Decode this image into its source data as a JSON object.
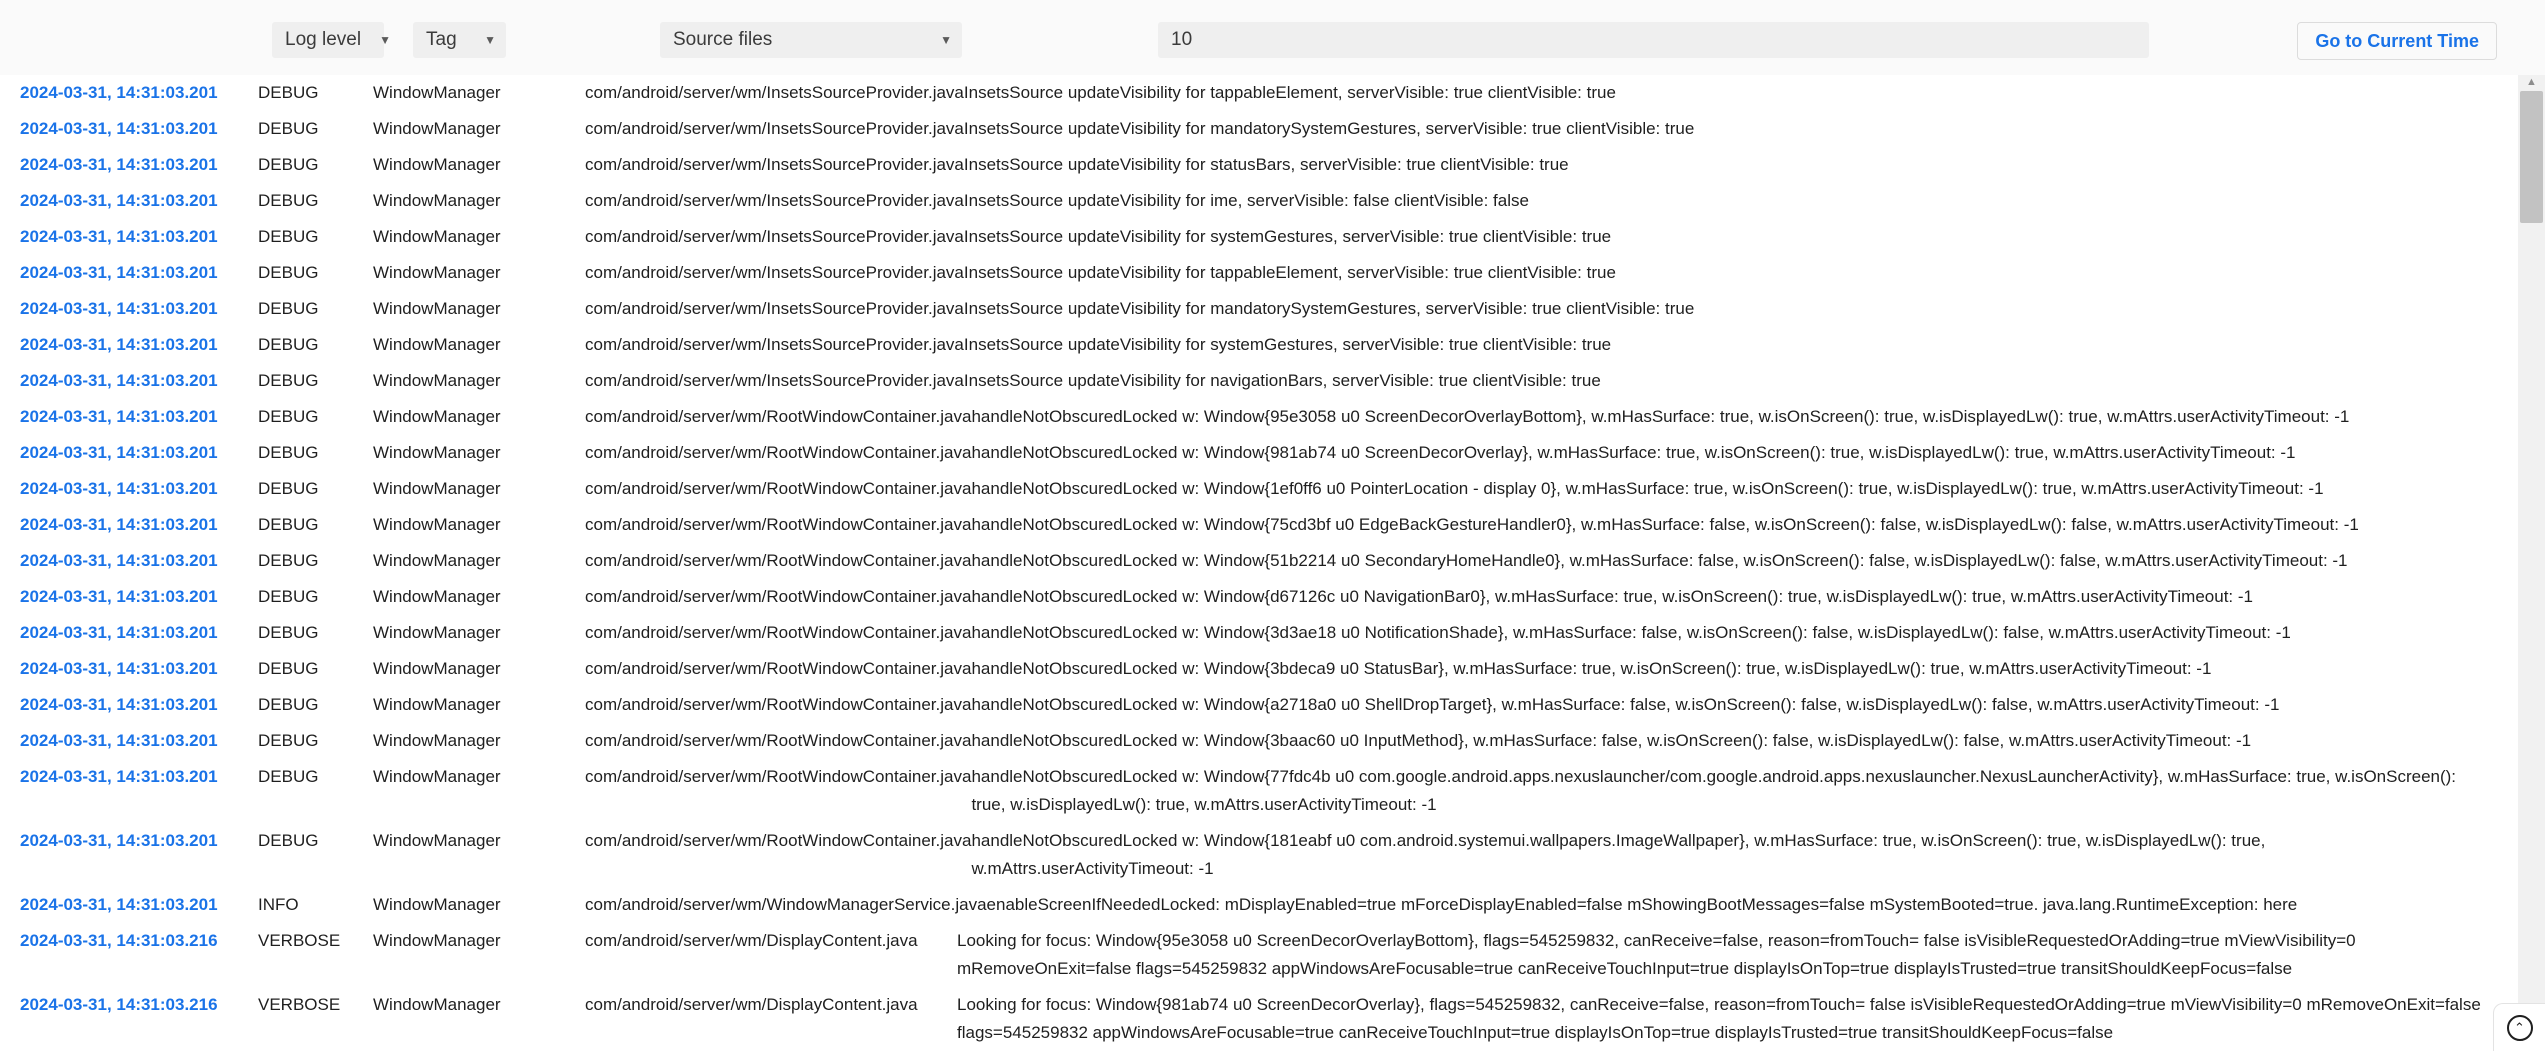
{
  "toolbar": {
    "log_level_label": "Log level",
    "tag_label": "Tag",
    "source_files_label": "Source files",
    "caret_glyph": "▼",
    "search_value": "10",
    "search_placeholder": "",
    "goto_current_time_label": "Go to Current Time"
  },
  "scrollbar": {
    "up_glyph": "▲",
    "down_glyph": "▼"
  },
  "scroll_to_top": {
    "glyph": "⌃"
  },
  "columns": [
    "timestamp",
    "level",
    "tag",
    "source",
    "message"
  ],
  "rows": [
    {
      "timestamp": "2024-03-31, 14:31:03.201",
      "level": "DEBUG",
      "tag": "WindowManager",
      "source": "com/android/server/wm/InsetsSourceProvider.java",
      "message": "InsetsSource updateVisibility for tappableElement, serverVisible: true clientVisible: true"
    },
    {
      "timestamp": "2024-03-31, 14:31:03.201",
      "level": "DEBUG",
      "tag": "WindowManager",
      "source": "com/android/server/wm/InsetsSourceProvider.java",
      "message": "InsetsSource updateVisibility for mandatorySystemGestures, serverVisible: true clientVisible: true"
    },
    {
      "timestamp": "2024-03-31, 14:31:03.201",
      "level": "DEBUG",
      "tag": "WindowManager",
      "source": "com/android/server/wm/InsetsSourceProvider.java",
      "message": "InsetsSource updateVisibility for statusBars, serverVisible: true clientVisible: true"
    },
    {
      "timestamp": "2024-03-31, 14:31:03.201",
      "level": "DEBUG",
      "tag": "WindowManager",
      "source": "com/android/server/wm/InsetsSourceProvider.java",
      "message": "InsetsSource updateVisibility for ime, serverVisible: false clientVisible: false"
    },
    {
      "timestamp": "2024-03-31, 14:31:03.201",
      "level": "DEBUG",
      "tag": "WindowManager",
      "source": "com/android/server/wm/InsetsSourceProvider.java",
      "message": "InsetsSource updateVisibility for systemGestures, serverVisible: true clientVisible: true"
    },
    {
      "timestamp": "2024-03-31, 14:31:03.201",
      "level": "DEBUG",
      "tag": "WindowManager",
      "source": "com/android/server/wm/InsetsSourceProvider.java",
      "message": "InsetsSource updateVisibility for tappableElement, serverVisible: true clientVisible: true"
    },
    {
      "timestamp": "2024-03-31, 14:31:03.201",
      "level": "DEBUG",
      "tag": "WindowManager",
      "source": "com/android/server/wm/InsetsSourceProvider.java",
      "message": "InsetsSource updateVisibility for mandatorySystemGestures, serverVisible: true clientVisible: true"
    },
    {
      "timestamp": "2024-03-31, 14:31:03.201",
      "level": "DEBUG",
      "tag": "WindowManager",
      "source": "com/android/server/wm/InsetsSourceProvider.java",
      "message": "InsetsSource updateVisibility for systemGestures, serverVisible: true clientVisible: true"
    },
    {
      "timestamp": "2024-03-31, 14:31:03.201",
      "level": "DEBUG",
      "tag": "WindowManager",
      "source": "com/android/server/wm/InsetsSourceProvider.java",
      "message": "InsetsSource updateVisibility for navigationBars, serverVisible: true clientVisible: true"
    },
    {
      "timestamp": "2024-03-31, 14:31:03.201",
      "level": "DEBUG",
      "tag": "WindowManager",
      "source": "com/android/server/wm/RootWindowContainer.java",
      "message": "handleNotObscuredLocked w: Window{95e3058 u0 ScreenDecorOverlayBottom}, w.mHasSurface: true, w.isOnScreen(): true, w.isDisplayedLw(): true, w.mAttrs.userActivityTimeout: -1"
    },
    {
      "timestamp": "2024-03-31, 14:31:03.201",
      "level": "DEBUG",
      "tag": "WindowManager",
      "source": "com/android/server/wm/RootWindowContainer.java",
      "message": "handleNotObscuredLocked w: Window{981ab74 u0 ScreenDecorOverlay}, w.mHasSurface: true, w.isOnScreen(): true, w.isDisplayedLw(): true, w.mAttrs.userActivityTimeout: -1"
    },
    {
      "timestamp": "2024-03-31, 14:31:03.201",
      "level": "DEBUG",
      "tag": "WindowManager",
      "source": "com/android/server/wm/RootWindowContainer.java",
      "message": "handleNotObscuredLocked w: Window{1ef0ff6 u0 PointerLocation - display 0}, w.mHasSurface: true, w.isOnScreen(): true, w.isDisplayedLw(): true, w.mAttrs.userActivityTimeout: -1"
    },
    {
      "timestamp": "2024-03-31, 14:31:03.201",
      "level": "DEBUG",
      "tag": "WindowManager",
      "source": "com/android/server/wm/RootWindowContainer.java",
      "message": "handleNotObscuredLocked w: Window{75cd3bf u0 EdgeBackGestureHandler0}, w.mHasSurface: false, w.isOnScreen(): false, w.isDisplayedLw(): false, w.mAttrs.userActivityTimeout: -1"
    },
    {
      "timestamp": "2024-03-31, 14:31:03.201",
      "level": "DEBUG",
      "tag": "WindowManager",
      "source": "com/android/server/wm/RootWindowContainer.java",
      "message": "handleNotObscuredLocked w: Window{51b2214 u0 SecondaryHomeHandle0}, w.mHasSurface: false, w.isOnScreen(): false, w.isDisplayedLw(): false, w.mAttrs.userActivityTimeout: -1"
    },
    {
      "timestamp": "2024-03-31, 14:31:03.201",
      "level": "DEBUG",
      "tag": "WindowManager",
      "source": "com/android/server/wm/RootWindowContainer.java",
      "message": "handleNotObscuredLocked w: Window{d67126c u0 NavigationBar0}, w.mHasSurface: true, w.isOnScreen(): true, w.isDisplayedLw(): true, w.mAttrs.userActivityTimeout: -1"
    },
    {
      "timestamp": "2024-03-31, 14:31:03.201",
      "level": "DEBUG",
      "tag": "WindowManager",
      "source": "com/android/server/wm/RootWindowContainer.java",
      "message": "handleNotObscuredLocked w: Window{3d3ae18 u0 NotificationShade}, w.mHasSurface: false, w.isOnScreen(): false, w.isDisplayedLw(): false, w.mAttrs.userActivityTimeout: -1"
    },
    {
      "timestamp": "2024-03-31, 14:31:03.201",
      "level": "DEBUG",
      "tag": "WindowManager",
      "source": "com/android/server/wm/RootWindowContainer.java",
      "message": "handleNotObscuredLocked w: Window{3bdeca9 u0 StatusBar}, w.mHasSurface: true, w.isOnScreen(): true, w.isDisplayedLw(): true, w.mAttrs.userActivityTimeout: -1"
    },
    {
      "timestamp": "2024-03-31, 14:31:03.201",
      "level": "DEBUG",
      "tag": "WindowManager",
      "source": "com/android/server/wm/RootWindowContainer.java",
      "message": "handleNotObscuredLocked w: Window{a2718a0 u0 ShellDropTarget}, w.mHasSurface: false, w.isOnScreen(): false, w.isDisplayedLw(): false, w.mAttrs.userActivityTimeout: -1"
    },
    {
      "timestamp": "2024-03-31, 14:31:03.201",
      "level": "DEBUG",
      "tag": "WindowManager",
      "source": "com/android/server/wm/RootWindowContainer.java",
      "message": "handleNotObscuredLocked w: Window{3baac60 u0 InputMethod}, w.mHasSurface: false, w.isOnScreen(): false, w.isDisplayedLw(): false, w.mAttrs.userActivityTimeout: -1"
    },
    {
      "timestamp": "2024-03-31, 14:31:03.201",
      "level": "DEBUG",
      "tag": "WindowManager",
      "source": "com/android/server/wm/RootWindowContainer.java",
      "message": "handleNotObscuredLocked w: Window{77fdc4b u0 com.google.android.apps.nexuslauncher/com.google.android.apps.nexuslauncher.NexusLauncherActivity}, w.mHasSurface: true, w.isOnScreen(): true, w.isDisplayedLw(): true, w.mAttrs.userActivityTimeout: -1"
    },
    {
      "timestamp": "2024-03-31, 14:31:03.201",
      "level": "DEBUG",
      "tag": "WindowManager",
      "source": "com/android/server/wm/RootWindowContainer.java",
      "message": "handleNotObscuredLocked w: Window{181eabf u0 com.android.systemui.wallpapers.ImageWallpaper}, w.mHasSurface: true, w.isOnScreen(): true, w.isDisplayedLw(): true, w.mAttrs.userActivityTimeout: -1"
    },
    {
      "timestamp": "2024-03-31, 14:31:03.201",
      "level": "INFO",
      "tag": "WindowManager",
      "source": "com/android/server/wm/WindowManagerService.java",
      "message": "enableScreenIfNeededLocked: mDisplayEnabled=true mForceDisplayEnabled=false mShowingBootMessages=false mSystemBooted=true. java.lang.RuntimeException: here"
    },
    {
      "timestamp": "2024-03-31, 14:31:03.216",
      "level": "VERBOSE",
      "tag": "WindowManager",
      "source": "com/android/server/wm/DisplayContent.java",
      "message": "Looking for focus: Window{95e3058 u0 ScreenDecorOverlayBottom}, flags=545259832, canReceive=false, reason=fromTouch= false isVisibleRequestedOrAdding=true mViewVisibility=0 mRemoveOnExit=false flags=545259832 appWindowsAreFocusable=true canReceiveTouchInput=true displayIsOnTop=true displayIsTrusted=true transitShouldKeepFocus=false"
    },
    {
      "timestamp": "2024-03-31, 14:31:03.216",
      "level": "VERBOSE",
      "tag": "WindowManager",
      "source": "com/android/server/wm/DisplayContent.java",
      "message": "Looking for focus: Window{981ab74 u0 ScreenDecorOverlay}, flags=545259832, canReceive=false, reason=fromTouch= false isVisibleRequestedOrAdding=true mViewVisibility=0 mRemoveOnExit=false flags=545259832 appWindowsAreFocusable=true canReceiveTouchInput=true displayIsOnTop=true displayIsTrusted=true transitShouldKeepFocus=false"
    }
  ]
}
